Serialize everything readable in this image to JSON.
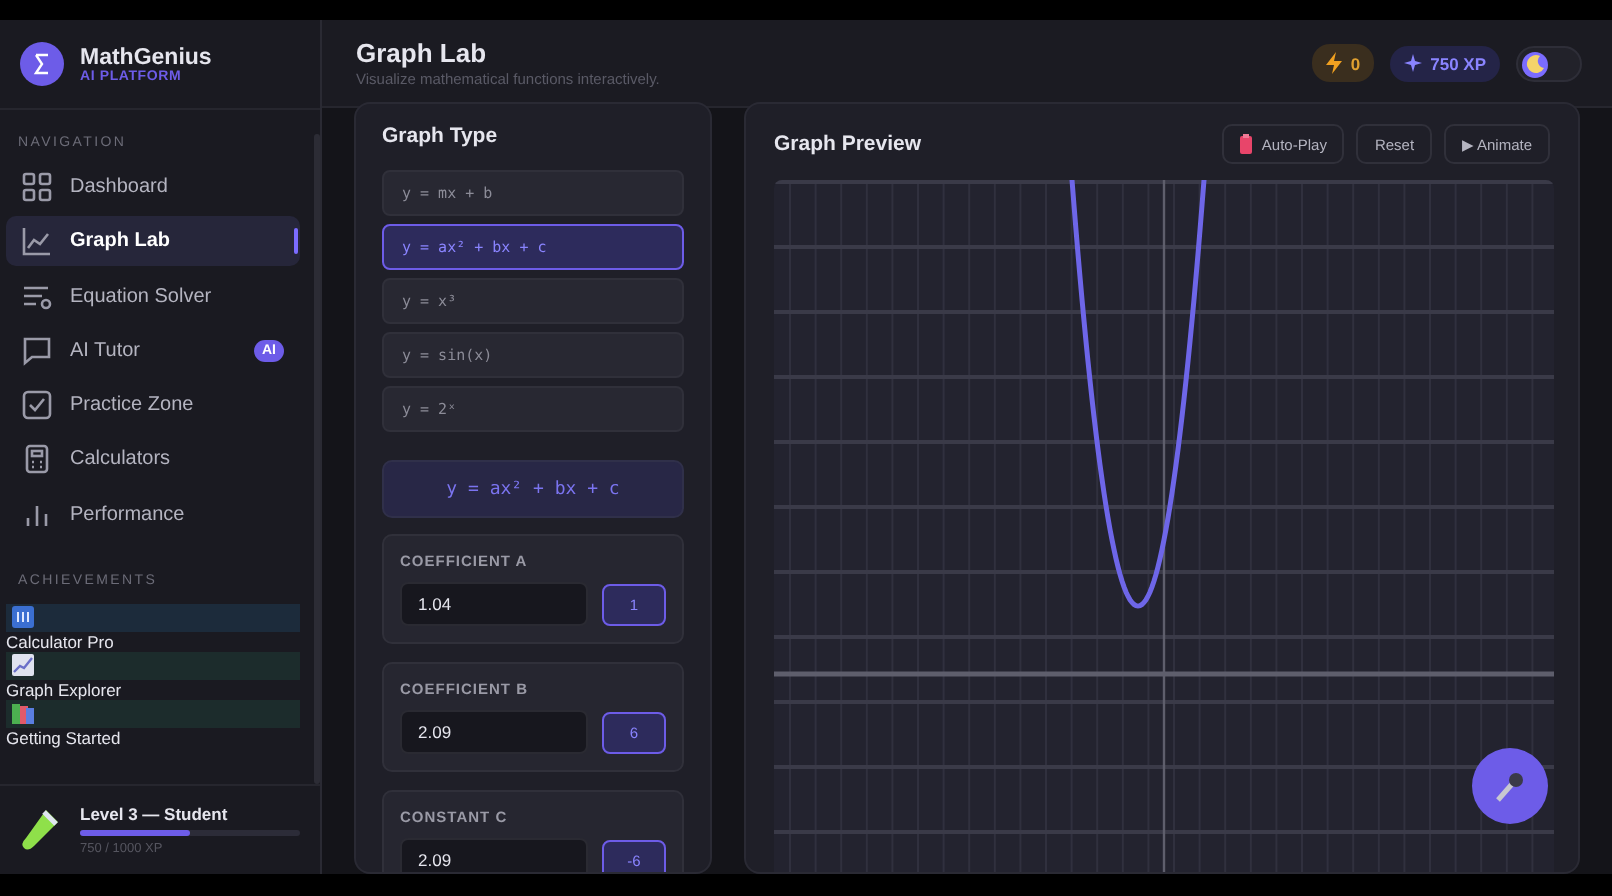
{
  "sidebar": {
    "brand": {
      "name": "MathGenius",
      "tagline": "AI PLATFORM"
    },
    "nav_heading": "NAVIGATION",
    "nav_items": [
      {
        "label": "Dashboard",
        "selected": false
      },
      {
        "label": "Graph Lab",
        "selected": true
      },
      {
        "label": "Equation Solver",
        "selected": false
      },
      {
        "label": "AI Tutor",
        "selected": false,
        "badge": "AI"
      },
      {
        "label": "Practice Zone",
        "selected": false
      },
      {
        "label": "Calculators",
        "selected": false
      },
      {
        "label": "Performance",
        "selected": false
      }
    ],
    "achievements_heading": "ACHIEVEMENTS",
    "achievements": [
      {
        "label": "Calculator Pro",
        "color": "#1c2b3b"
      },
      {
        "label": "Graph Explorer",
        "color": "#1c2c2c"
      },
      {
        "label": "Getting Started",
        "color": "#1c2c2c"
      }
    ],
    "level": {
      "title": "Level 3 — Student",
      "level": 0.5,
      "xp": "750 / 1000 XP"
    }
  },
  "header": {
    "title": "Graph Lab",
    "subtitle": "Visualize mathematical functions interactively.",
    "streak": "0",
    "xp": "750 XP",
    "toggle_on": false
  },
  "graph_type": {
    "title": "Graph Type",
    "options": [
      {
        "label": "y = mx + b",
        "selected": false
      },
      {
        "label": "y = ax² + bx + c",
        "selected": true
      },
      {
        "label": "y = x³",
        "selected": false
      },
      {
        "label": "y = sin(x)",
        "selected": false
      },
      {
        "label": "y = 2ˣ",
        "selected": false
      }
    ],
    "formula": "y = ax² + bx + c",
    "coefficients": [
      {
        "label": "COEFFICIENT A",
        "value": "1.04",
        "badge": "1"
      },
      {
        "label": "COEFFICIENT B",
        "value": "2.09",
        "badge": "6"
      },
      {
        "label": "CONSTANT C",
        "value": "2.09",
        "badge": "-6"
      }
    ]
  },
  "preview": {
    "title": "Graph Preview",
    "buttons": [
      {
        "kind": "autoplay",
        "label": "Auto-Play"
      },
      {
        "kind": "plain",
        "label": "Reset"
      },
      {
        "kind": "plain",
        "label": "▶ Animate"
      }
    ]
  }
}
